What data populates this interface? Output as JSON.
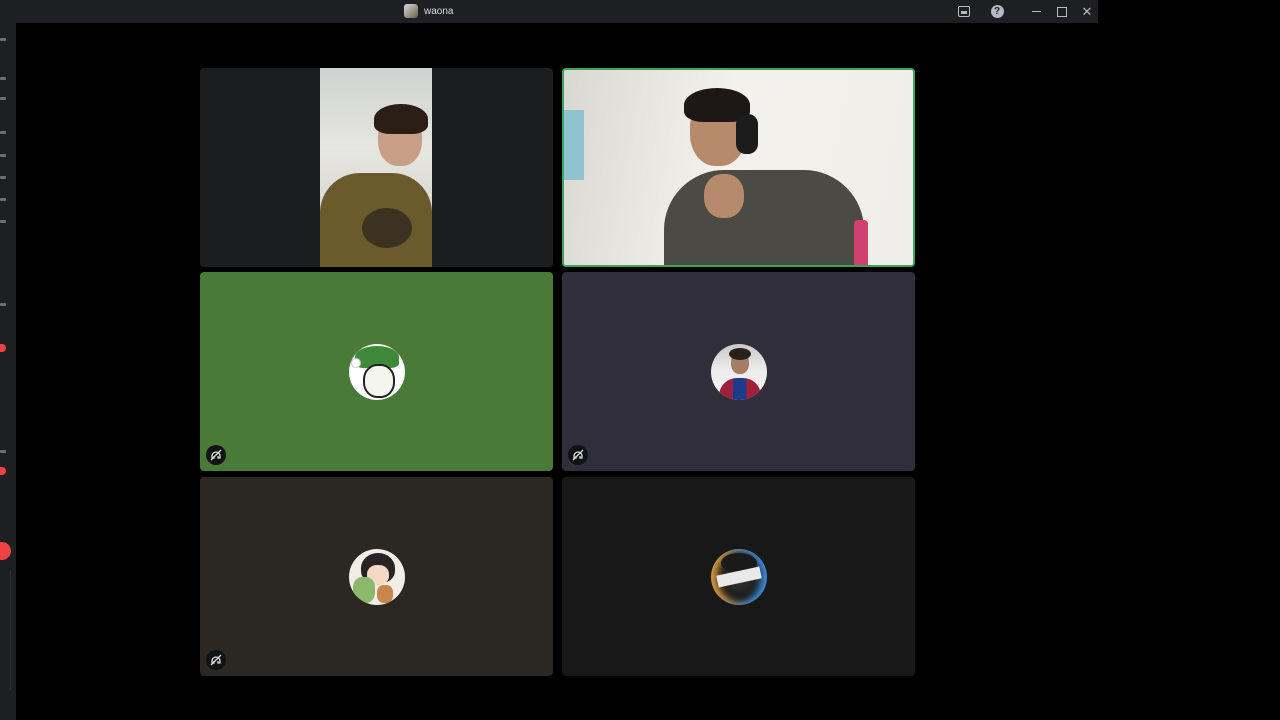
{
  "window": {
    "title": "waona"
  },
  "title_bar": {
    "buttons": [
      "inbox-icon",
      "help-icon",
      "minimize-icon",
      "maximize-icon",
      "close-icon"
    ],
    "help_glyph": "?",
    "close_glyph": "✕"
  },
  "accent_colors": {
    "speaking_border": "#3ba55c",
    "badge_red": "#ed4245"
  },
  "tiles": [
    {
      "type": "camera",
      "speaking": false
    },
    {
      "type": "camera",
      "speaking": true
    },
    {
      "type": "avatar",
      "avatar": "pepe-avatar",
      "background": "#4a7a38",
      "deafened": true
    },
    {
      "type": "avatar",
      "avatar": "messi-avatar",
      "background": "#2f2e3a",
      "deafened": true
    },
    {
      "type": "avatar",
      "avatar": "anime-avatar",
      "background": "#2b2823",
      "deafened": true
    },
    {
      "type": "avatar",
      "avatar": "ninja-avatar",
      "background": "#181818",
      "deafened": false
    }
  ]
}
